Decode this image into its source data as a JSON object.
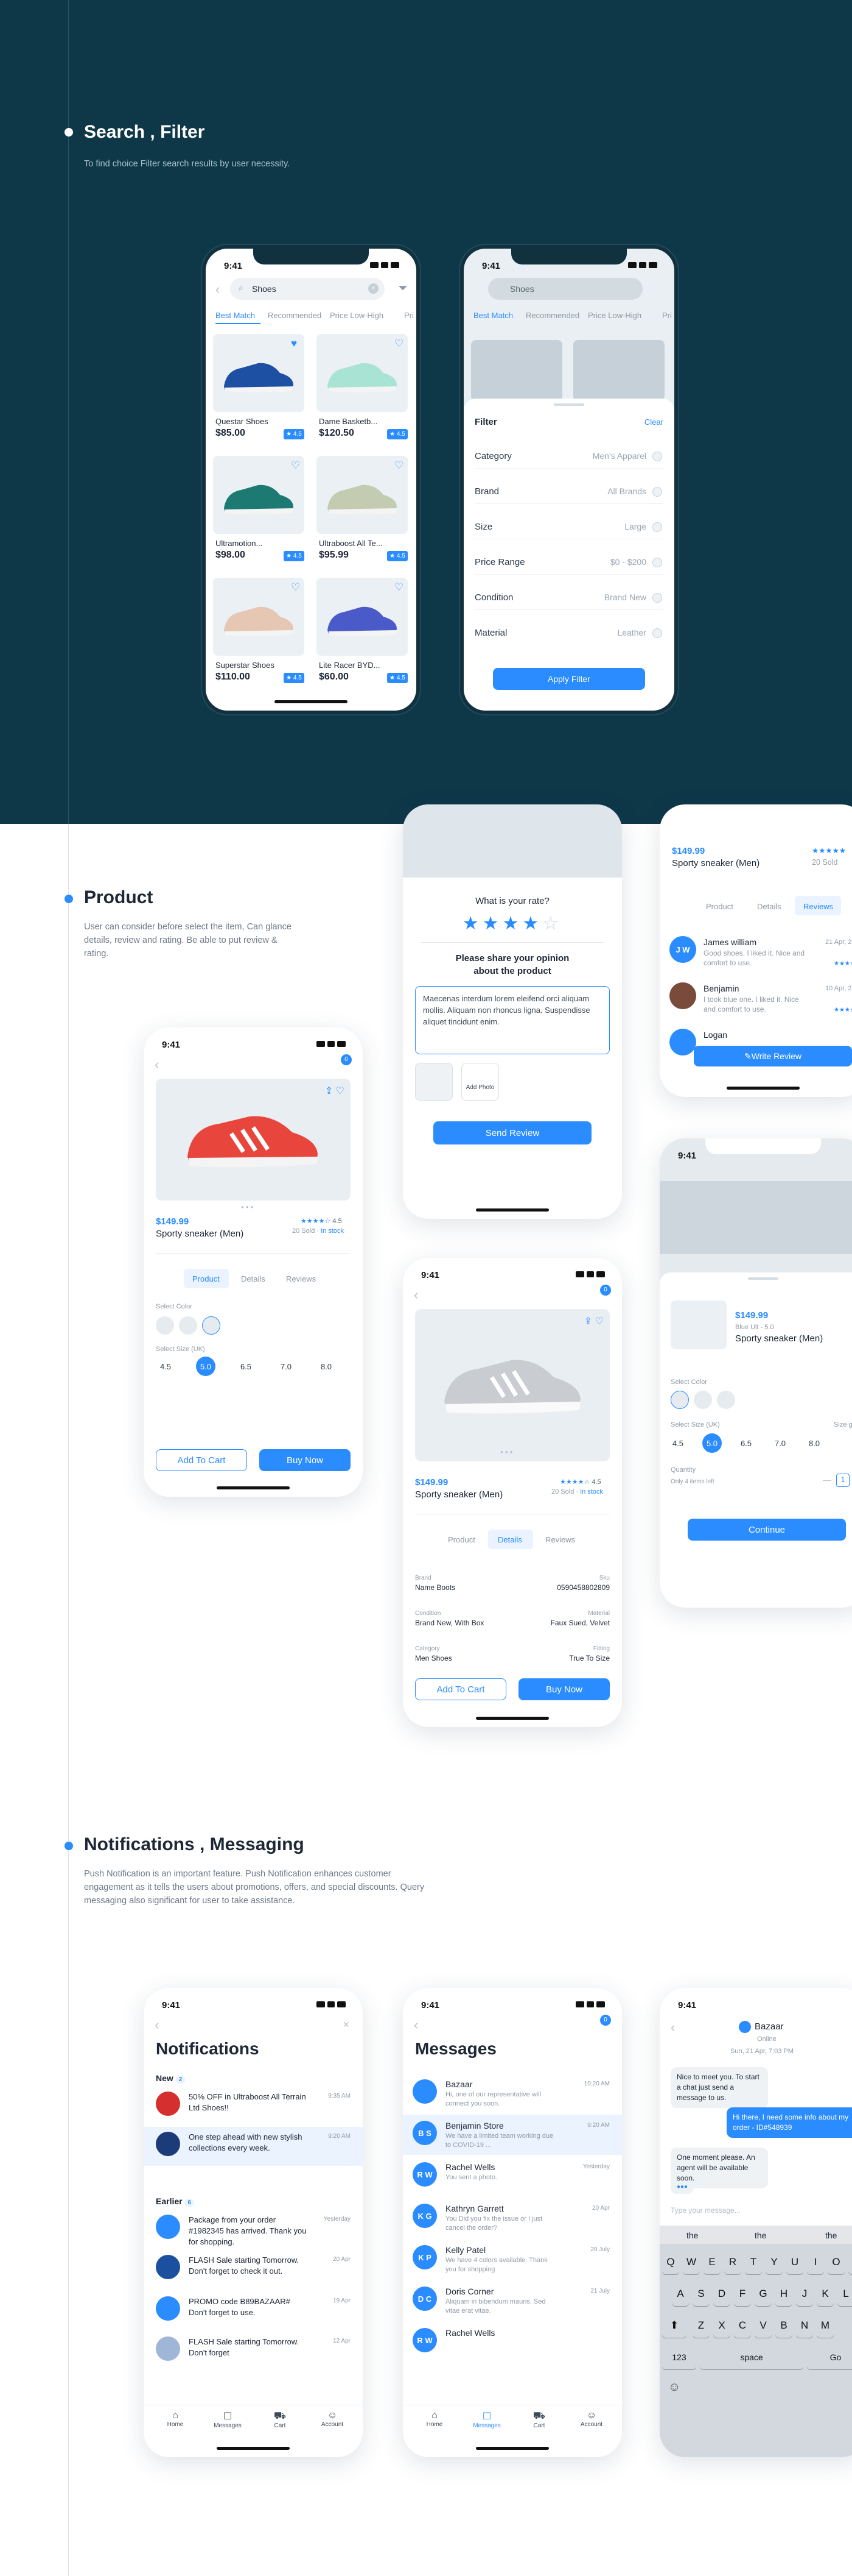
{
  "sections": {
    "search": {
      "title": "Search , Filter",
      "desc": "To find choice Filter search results by user necessity."
    },
    "product": {
      "title": "Product",
      "desc": "User can consider before select the item, Can glance details, review and rating. Be able to put review & rating."
    },
    "notif": {
      "title": "Notifications , Messaging",
      "desc": "Push Notification is an important feature. Push Notification enhances customer engagement as it tells the users about promotions, offers, and special discounts. Query  messaging also significant for user to take assistance."
    }
  },
  "status_time": "9:41",
  "search": {
    "query": "Shoes",
    "tabs": [
      "Best Match",
      "Recommended",
      "Price Low-High",
      "Pri"
    ],
    "products": [
      {
        "name": "Questar Shoes",
        "price": "$85.00",
        "rating": "★ 4.5"
      },
      {
        "name": "Dame Basketb...",
        "price": "$120.50",
        "rating": "★ 4.5"
      },
      {
        "name": "Ultramotion...",
        "price": "$98.00",
        "rating": "★ 4.5"
      },
      {
        "name": "Ultraboost All Te...",
        "price": "$95.99",
        "rating": "★ 4.5"
      },
      {
        "name": "Superstar Shoes",
        "price": "$110.00",
        "rating": "★ 4.5"
      },
      {
        "name": "Lite Racer BYD...",
        "price": "$60.00",
        "rating": "★ 4.5"
      }
    ]
  },
  "filter": {
    "title": "Filter",
    "clear": "Clear",
    "rows": [
      {
        "label": "Category",
        "value": "Men's Apparel"
      },
      {
        "label": "Brand",
        "value": "All Brands"
      },
      {
        "label": "Size",
        "value": "Large"
      },
      {
        "label": "Price Range",
        "value": "$0 - $200"
      },
      {
        "label": "Condition",
        "value": "Brand New"
      },
      {
        "label": "Material",
        "value": "Leather"
      }
    ],
    "apply": "Apply Filter"
  },
  "review": {
    "question": "What is your rate?",
    "prompt": "Please share your opinion about the product",
    "text": "Maecenas interdum lorem eleifend orci aliquam mollis. Aliquam non rhoncus ligna. Suspendisse aliquet tincidunt enim.",
    "add_photo": "Add Photo",
    "send": "Send Review"
  },
  "product": {
    "price": "$149.99",
    "name": "Sporty sneaker (Men)",
    "rating": "4.5",
    "sold": "20 Sold",
    "stock": "In stock",
    "tabs": [
      "Product",
      "Details",
      "Reviews"
    ],
    "select_color": "Select Color",
    "select_size": "Select Size (UK)",
    "sizes": [
      "4.5",
      "5.0",
      "6.5",
      "7.0",
      "8.0"
    ],
    "add_cart": "Add To Cart",
    "buy": "Buy Now"
  },
  "details": {
    "fields": [
      {
        "l": "Brand",
        "v": "Name Boots",
        "rl": "Sku",
        "rv": "0590458802809"
      },
      {
        "l": "Condition",
        "v": "Brand New, With Box",
        "rl": "Material",
        "rv": "Faux Sued, Velvet"
      },
      {
        "l": "Category",
        "v": "Men Shoes",
        "rl": "Fitting",
        "rv": "True To Size"
      }
    ]
  },
  "reviews": {
    "items": [
      {
        "name": "James william",
        "date": "21 Apr, 2",
        "text": "Good shoes, I liked it. Nice and comfort to use.",
        "initials": "J W"
      },
      {
        "name": "Benjamin",
        "date": "10 Apr, 2",
        "text": "I took blue one. I liked it. Nice and comfort to use.",
        "initials": ""
      },
      {
        "name": "Logan",
        "date": "",
        "text": "",
        "initials": ""
      }
    ],
    "write": "Write Review"
  },
  "select": {
    "variant": "Blue Ult - 5.0",
    "quantity": "Quantity",
    "only_left": "Only 4 items left",
    "qty": "1",
    "size_label": "Size gu",
    "continue": "Continue"
  },
  "notifications": {
    "title": "Notifications",
    "new": "New",
    "new_count": "2",
    "earlier": "Earlier",
    "earlier_count": "6",
    "items": [
      {
        "text": "50% OFF in Ultraboost All Terrain Ltd Shoes!!",
        "time": "9:35 AM"
      },
      {
        "text": "One step ahead with new stylish collections every week.",
        "time": "9:20 AM"
      },
      {
        "text": "Package from your order #1982345 has arrived. Thank you for shopping.",
        "time": "Yesterday"
      },
      {
        "text": "FLASH Sale starting Tomorrow. Don't forget to check it out.",
        "time": "20 Apr"
      },
      {
        "text": "PROMO code B89BAZAAR# Don't forget to use.",
        "time": "19 Apr"
      },
      {
        "text": "FLASH Sale starting Tomorrow. Don't forget",
        "time": "12 Apr"
      }
    ]
  },
  "nav": [
    "Home",
    "Messages",
    "Cart",
    "Account"
  ],
  "messages": {
    "title": "Messages",
    "items": [
      {
        "name": "Bazaar",
        "preview": "Hi, one of our representative will connect you soon.",
        "time": "10:20 AM",
        "initials": ""
      },
      {
        "name": "Benjamin Store",
        "preview": "We have a limited team working due to COVID-19 ...",
        "time": "9:20 AM",
        "initials": "B S"
      },
      {
        "name": "Rachel Wells",
        "preview": "You sent a photo.",
        "time": "Yesterday",
        "initials": "R W"
      },
      {
        "name": "Kathryn Garrett",
        "preview": "You Did you fix the issue or I just cancel the order?",
        "time": "20 Apr",
        "initials": "K G"
      },
      {
        "name": "Kelly Patel",
        "preview": "We have 4 colors available. Thank you for shopping",
        "time": "20 July",
        "initials": "K P"
      },
      {
        "name": "Doris Corner",
        "preview": "Aliquam in bibendum mauris. Sed vitae erat vitae.",
        "time": "21 July",
        "initials": "D C"
      },
      {
        "name": "Rachel Wells",
        "preview": "",
        "time": "",
        "initials": "R W"
      }
    ]
  },
  "chat": {
    "name": "Bazaar",
    "status": "Online",
    "date": "Sun, 21 Apr, 7:03 PM",
    "m1": "Nice to meet you. To start a chat just send a message to us.",
    "m2": "Hi there, I need some info about my order - ID#548939",
    "m3": "One moment please. An agent will be available soon.",
    "placeholder": "Type your message...",
    "suggestions": [
      "the",
      "the",
      "the"
    ],
    "row1": [
      "Q",
      "W",
      "E",
      "R",
      "T",
      "Y",
      "U",
      "I",
      "O",
      "P"
    ],
    "row2": [
      "A",
      "S",
      "D",
      "F",
      "G",
      "H",
      "J",
      "K",
      "L"
    ],
    "row3": [
      "Z",
      "X",
      "C",
      "V",
      "B",
      "N",
      "M"
    ],
    "k123": "123",
    "space": "space",
    "go": "Go"
  }
}
